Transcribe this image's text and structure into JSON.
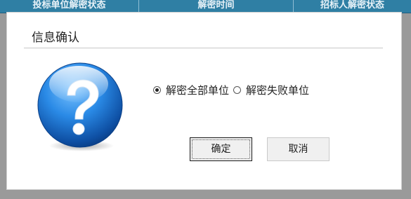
{
  "background_table": {
    "columns": [
      "投标单位解密状态",
      "解密时间",
      "招标人解密状态"
    ]
  },
  "dialog": {
    "title": "信息确认",
    "icon": "question-mark-icon",
    "options": [
      {
        "label": "解密全部单位",
        "selected": true
      },
      {
        "label": "解密失败单位",
        "selected": false
      }
    ],
    "buttons": {
      "ok_label": "确定",
      "cancel_label": "取消"
    }
  },
  "colors": {
    "header_blue": "#2f7fa4",
    "icon_blue": "#1f78d1",
    "overlay_gray": "#9a9a9a"
  }
}
